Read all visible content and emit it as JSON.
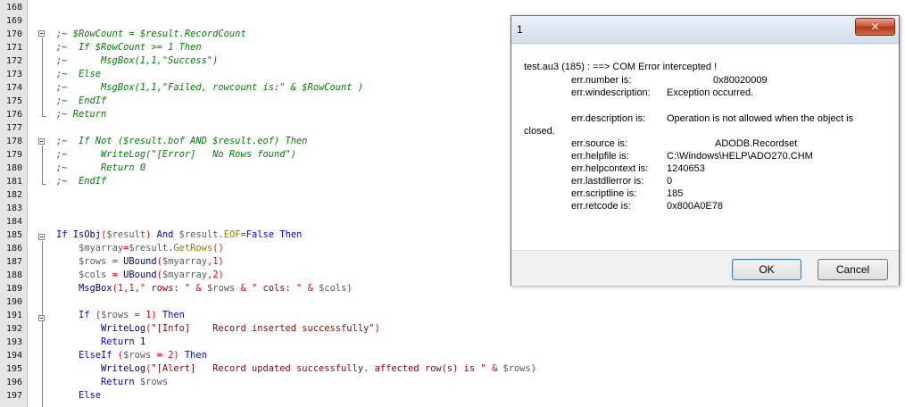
{
  "editor": {
    "lines": [
      {
        "n": "168",
        "segs": []
      },
      {
        "n": "169",
        "segs": []
      },
      {
        "n": "170",
        "segs": [
          {
            "t": ";~ $RowCount = $result.RecordCount",
            "c": "c-comment"
          }
        ]
      },
      {
        "n": "171",
        "segs": [
          {
            "t": ";~  If $RowCount >= 1 Then",
            "c": "c-comment"
          }
        ]
      },
      {
        "n": "172",
        "segs": [
          {
            "t": ";~      MsgBox(1,1,\"Success\")",
            "c": "c-comment"
          }
        ]
      },
      {
        "n": "173",
        "segs": [
          {
            "t": ";~  Else",
            "c": "c-comment"
          }
        ]
      },
      {
        "n": "174",
        "segs": [
          {
            "t": ";~      MsgBox(1,1,\"Failed, rowcount is:\" & $RowCount )",
            "c": "c-comment"
          }
        ]
      },
      {
        "n": "175",
        "segs": [
          {
            "t": ";~  EndIf",
            "c": "c-comment"
          }
        ]
      },
      {
        "n": "176",
        "segs": [
          {
            "t": ";~ Return",
            "c": "c-comment"
          }
        ]
      },
      {
        "n": "177",
        "segs": []
      },
      {
        "n": "178",
        "segs": [
          {
            "t": ";~  If Not ($result.bof AND $result.eof) Then",
            "c": "c-comment"
          }
        ]
      },
      {
        "n": "179",
        "segs": [
          {
            "t": ";~      WriteLog(\"[Error]   No Rows found\")",
            "c": "c-comment"
          }
        ]
      },
      {
        "n": "180",
        "segs": [
          {
            "t": ";~      Return 0",
            "c": "c-comment"
          }
        ]
      },
      {
        "n": "181",
        "segs": [
          {
            "t": ";~  EndIf",
            "c": "c-comment"
          }
        ]
      },
      {
        "n": "182",
        "segs": []
      },
      {
        "n": "183",
        "segs": []
      },
      {
        "n": "184",
        "segs": []
      },
      {
        "n": "185",
        "segs": [
          {
            "t": "If ",
            "c": "c-kw"
          },
          {
            "t": "IsObj",
            "c": "c-fn"
          },
          {
            "t": "(",
            "c": "c-op"
          },
          {
            "t": "$result",
            "c": "c-var"
          },
          {
            "t": ") ",
            "c": "c-op"
          },
          {
            "t": "And ",
            "c": "c-kw"
          },
          {
            "t": "$result",
            "c": "c-var"
          },
          {
            "t": ".",
            "c": "c-op"
          },
          {
            "t": "EOF",
            "c": "c-meth"
          },
          {
            "t": "=",
            "c": "c-op"
          },
          {
            "t": "False ",
            "c": "c-kw"
          },
          {
            "t": "Then",
            "c": "c-kw"
          }
        ]
      },
      {
        "n": "186",
        "segs": [
          {
            "t": "    ",
            "c": ""
          },
          {
            "t": "$myarray",
            "c": "c-var"
          },
          {
            "t": "=",
            "c": "c-op"
          },
          {
            "t": "$result",
            "c": "c-var"
          },
          {
            "t": ".",
            "c": "c-op"
          },
          {
            "t": "GetRows",
            "c": "c-meth"
          },
          {
            "t": "()",
            "c": "c-op"
          }
        ]
      },
      {
        "n": "187",
        "segs": [
          {
            "t": "    ",
            "c": ""
          },
          {
            "t": "$rows",
            "c": "c-var"
          },
          {
            "t": " = ",
            "c": "c-op"
          },
          {
            "t": "UBound",
            "c": "c-fn"
          },
          {
            "t": "(",
            "c": "c-op"
          },
          {
            "t": "$myarray",
            "c": "c-var"
          },
          {
            "t": ",1)",
            "c": "c-op"
          }
        ]
      },
      {
        "n": "188",
        "segs": [
          {
            "t": "    ",
            "c": ""
          },
          {
            "t": "$cols",
            "c": "c-var"
          },
          {
            "t": " = ",
            "c": "c-op"
          },
          {
            "t": "UBound",
            "c": "c-fn"
          },
          {
            "t": "(",
            "c": "c-op"
          },
          {
            "t": "$myarray",
            "c": "c-var"
          },
          {
            "t": ",2)",
            "c": "c-op"
          }
        ]
      },
      {
        "n": "189",
        "segs": [
          {
            "t": "    ",
            "c": ""
          },
          {
            "t": "MsgBox",
            "c": "c-fn"
          },
          {
            "t": "(1,1,",
            "c": "c-op"
          },
          {
            "t": "\" rows: \"",
            "c": "c-str"
          },
          {
            "t": " & ",
            "c": "c-op"
          },
          {
            "t": "$rows",
            "c": "c-var"
          },
          {
            "t": " & ",
            "c": "c-op"
          },
          {
            "t": "\" cols: \"",
            "c": "c-str"
          },
          {
            "t": " & ",
            "c": "c-op"
          },
          {
            "t": "$cols",
            "c": "c-var"
          },
          {
            "t": ")",
            "c": "c-op"
          }
        ]
      },
      {
        "n": "190",
        "segs": []
      },
      {
        "n": "191",
        "segs": [
          {
            "t": "    ",
            "c": ""
          },
          {
            "t": "If ",
            "c": "c-kw"
          },
          {
            "t": "(",
            "c": "c-op"
          },
          {
            "t": "$rows",
            "c": "c-var"
          },
          {
            "t": " = 1) ",
            "c": "c-op"
          },
          {
            "t": "Then",
            "c": "c-kw"
          }
        ]
      },
      {
        "n": "192",
        "segs": [
          {
            "t": "        ",
            "c": ""
          },
          {
            "t": "WriteLog",
            "c": "c-fn"
          },
          {
            "t": "(",
            "c": "c-op"
          },
          {
            "t": "\"[Info]    Record inserted successfully\"",
            "c": "c-str"
          },
          {
            "t": ")",
            "c": "c-op"
          }
        ]
      },
      {
        "n": "193",
        "segs": [
          {
            "t": "        ",
            "c": ""
          },
          {
            "t": "Return ",
            "c": "c-kw"
          },
          {
            "t": "1",
            "c": "c-num"
          }
        ]
      },
      {
        "n": "194",
        "segs": [
          {
            "t": "    ",
            "c": ""
          },
          {
            "t": "ElseIf ",
            "c": "c-kw"
          },
          {
            "t": "(",
            "c": "c-op"
          },
          {
            "t": "$rows",
            "c": "c-var"
          },
          {
            "t": " = 2) ",
            "c": "c-op"
          },
          {
            "t": "Then",
            "c": "c-kw"
          }
        ]
      },
      {
        "n": "195",
        "segs": [
          {
            "t": "        ",
            "c": ""
          },
          {
            "t": "WriteLog",
            "c": "c-fn"
          },
          {
            "t": "(",
            "c": "c-op"
          },
          {
            "t": "\"[Alert]   Record updated successfully. affected row(s) is \"",
            "c": "c-str"
          },
          {
            "t": " & ",
            "c": "c-op"
          },
          {
            "t": "$rows",
            "c": "c-var"
          },
          {
            "t": ")",
            "c": "c-op"
          }
        ]
      },
      {
        "n": "196",
        "segs": [
          {
            "t": "        ",
            "c": ""
          },
          {
            "t": "Return ",
            "c": "c-kw"
          },
          {
            "t": "$rows",
            "c": "c-var"
          }
        ]
      },
      {
        "n": "197",
        "segs": [
          {
            "t": "    ",
            "c": ""
          },
          {
            "t": "Else",
            "c": "c-kw"
          }
        ]
      }
    ]
  },
  "dialog": {
    "title": "1",
    "close_label": "✕",
    "header_line": "test.au3 (185) : ==> COM Error intercepted !",
    "rows": [
      {
        "label": "err.number is:",
        "value": "0x80020009"
      },
      {
        "label": "err.windescription:",
        "value": "Exception occurred."
      },
      {
        "label": "err.description is:",
        "value": "Operation is not allowed when the object is"
      },
      {
        "label": "err.source is:",
        "value": "ADODB.Recordset"
      },
      {
        "label": "err.helpfile is:",
        "value": "C:\\Windows\\HELP\\ADO270.CHM"
      },
      {
        "label": "err.helpcontext is:",
        "value": "1240653"
      },
      {
        "label": "err.lastdllerror is:",
        "value": "0"
      },
      {
        "label": "err.scriptline is:",
        "value": "185"
      },
      {
        "label": "err.retcode is:",
        "value": "0x800A0E78"
      }
    ],
    "wrap_text": "closed.",
    "ok_label": "OK",
    "cancel_label": "Cancel"
  }
}
